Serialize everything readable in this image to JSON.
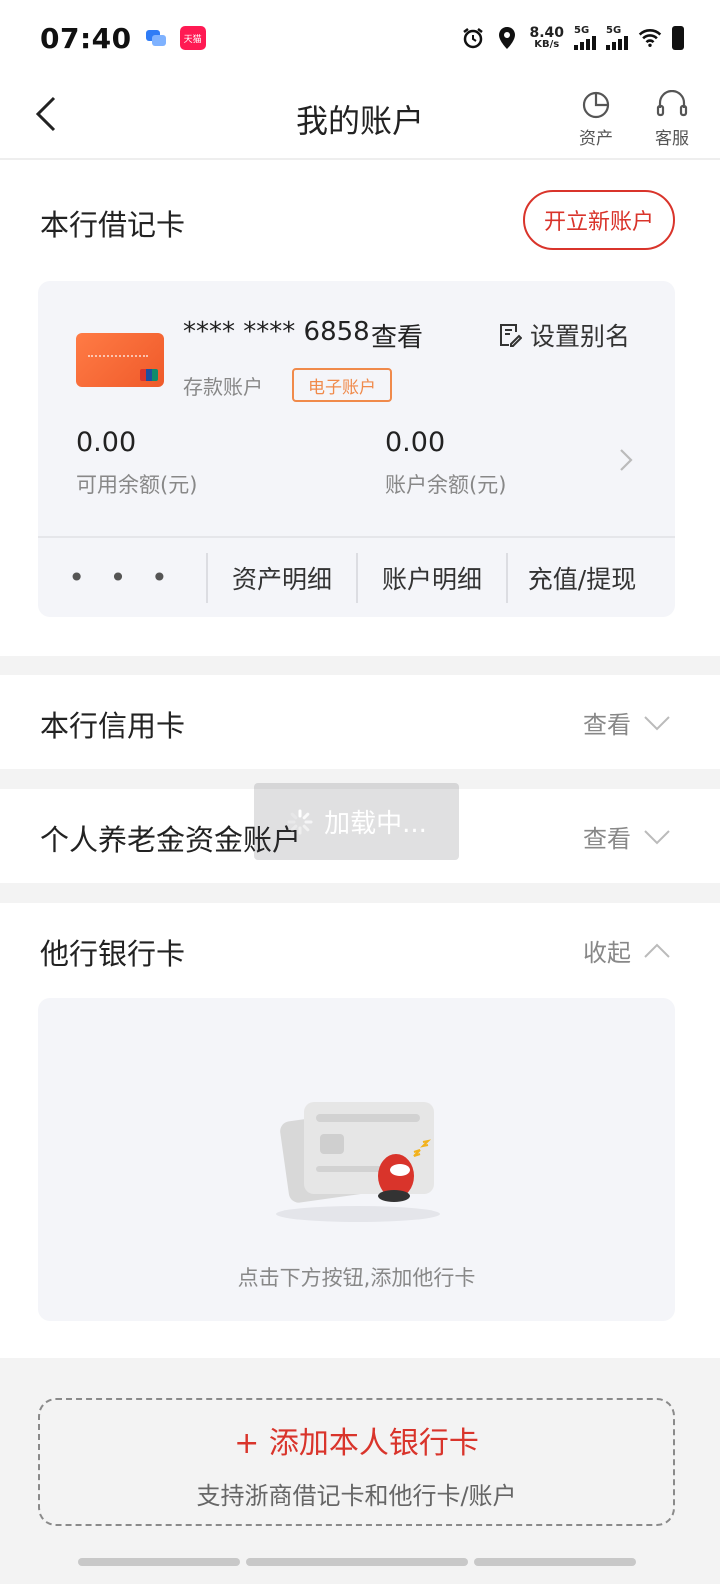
{
  "status_bar": {
    "time": "07:40",
    "tmall_label": "天猫",
    "net_speed": "8.40",
    "net_speed_unit": "KB/s",
    "sim1": "5G",
    "sim2": "5G"
  },
  "header": {
    "title": "我的账户",
    "assets_label": "资产",
    "service_label": "客服"
  },
  "debit_section": {
    "title": "本行借记卡",
    "open_account_label": "开立新账户",
    "card": {
      "masked_number": "**** **** 6858",
      "view_label": "查看",
      "alias_label": "设置别名",
      "account_type": "存款账户",
      "badge": "电子账户",
      "available_balance": "0.00",
      "available_balance_label": "可用余额(元)",
      "account_balance": "0.00",
      "account_balance_label": "账户余额(元)"
    },
    "actions": {
      "more": "• • •",
      "asset_detail": "资产明细",
      "account_detail": "账户明细",
      "topup_withdraw": "充值/提现"
    }
  },
  "credit_section": {
    "title": "本行信用卡",
    "action": "查看"
  },
  "pension_section": {
    "title": "个人养老金资金账户",
    "action": "查看"
  },
  "other_bank_section": {
    "title": "他行银行卡",
    "action": "收起",
    "empty_hint": "点击下方按钮,添加他行卡"
  },
  "add_card": {
    "title": "+ 添加本人银行卡",
    "subtitle": "支持浙商借记卡和他行卡/账户"
  },
  "loading": {
    "text": "加载中..."
  },
  "colors": {
    "accent": "#d9342b",
    "badge": "#f08a4b",
    "panel_bg": "#f4f5f9"
  }
}
